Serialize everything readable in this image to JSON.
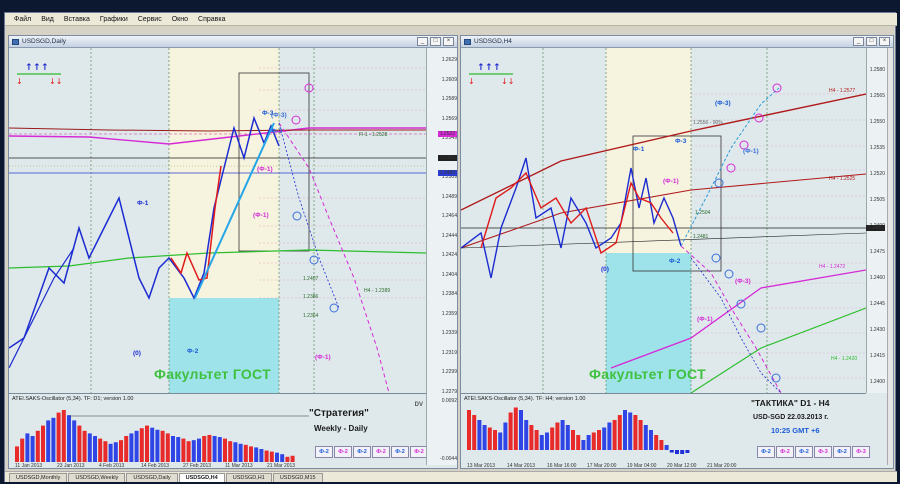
{
  "menu": [
    "Файл",
    "Вид",
    "Вставка",
    "Графики",
    "Сервис",
    "Окно",
    "Справка"
  ],
  "left_window": {
    "title": "USDSGD,Daily",
    "prices": [
      "1.2629",
      "1.2609",
      "1.2589",
      "1.2569",
      "1.2549",
      "1.2529",
      "1.2509",
      "1.2489",
      "1.2464",
      "1.2444",
      "1.2424",
      "1.2404",
      "1.2384",
      "1.2359",
      "1.2339",
      "1.2319",
      "1.2299",
      "1.2279"
    ],
    "tag_values": [
      "1.2522",
      "1.2493",
      "1.2480"
    ],
    "labels": [
      "Ф-3",
      "(Ф-3)",
      "Ф-1",
      "(0)",
      "Ф-2",
      "(Ф-1)",
      "(Ф-1)",
      "(Ф-1)",
      "Ф-3"
    ],
    "level_labels": [
      "1.2407",
      "1.2386",
      "1.2364",
      "Fl-1 - 1.2528",
      "H4 - 1.2389"
    ],
    "big_title": "Факультет ГОСТ",
    "osc_label": "ATEI.SAKS-Oscillator (5,34). TF: D1; version 1.00",
    "osc_scale": [
      "0.0092",
      "-0.0044"
    ],
    "osc_dv": "DV",
    "caption_title": "\"Стратегия\"",
    "caption_sub": "Weekly - Daily",
    "buttons": [
      "Ф-2",
      "Ф-2",
      "Ф-2",
      "Ф-2",
      "Ф-2",
      "Ф-2"
    ],
    "time_axis": [
      "11 Jan 2013",
      "23 Jan 2013",
      "4 Feb 2013",
      "14 Feb 2013",
      "27 Feb 2013",
      "11 Mar 2013",
      "21 Mar 2013"
    ]
  },
  "right_window": {
    "title": "USDSGD,H4",
    "prices": [
      "1.2580",
      "1.2565",
      "1.2550",
      "1.2535",
      "1.2520",
      "1.2505",
      "1.2490",
      "1.2475",
      "1.2460",
      "1.2445",
      "1.2430",
      "1.2415",
      "1.2400"
    ],
    "tag_value": "1.2490",
    "labels": [
      "Ф-1",
      "(0)",
      "Ф-2",
      "(Ф-3)",
      "(Ф-1)",
      "(Ф-1)",
      "(Ф-3)",
      "(Ф-1)",
      "Ф-3"
    ],
    "level_labels": [
      "H4 - 1.2577",
      "H4 - 1.2525",
      "H4 - 1.2472",
      "H4 - 1.2420",
      "1.2556 - 90%",
      "1.2504",
      "1.2481"
    ],
    "big_title": "Факультет ГОСТ",
    "osc_label": "ATEI.SAKS-Oscillator (5,34). TF: H4; version 1.00",
    "caption_title": "\"ТАКТИКА\"   D1 - H4",
    "caption_sub": "USD-SGD     22.03.2013 г.",
    "caption_time": "10:25  GMT +6",
    "buttons": [
      "Ф-2",
      "Ф-2",
      "Ф-2",
      "Ф-3",
      "Ф-2",
      "Ф-3"
    ],
    "time_axis": [
      "13 Mar 2013",
      "14 Mar 2013",
      "16 Mar 16:00",
      "17 Mar 20:00",
      "19 Mar 04:00",
      "20 Mar 12:00",
      "21 Mar 20:00"
    ]
  },
  "bottom_tabs": [
    "USDSGD,Monthly",
    "USDSGD,Weekly",
    "USDSGD,Daily",
    "USDSGD,H4",
    "USDSGD,H1",
    "USDSGD,M15"
  ],
  "active_tab": "USDSGD,H4",
  "colors": {
    "green_title": "#3fc13f",
    "blue_wave": "#1b2bd0",
    "red_wave": "#e01a1a",
    "magenta": "#d22ad2"
  }
}
